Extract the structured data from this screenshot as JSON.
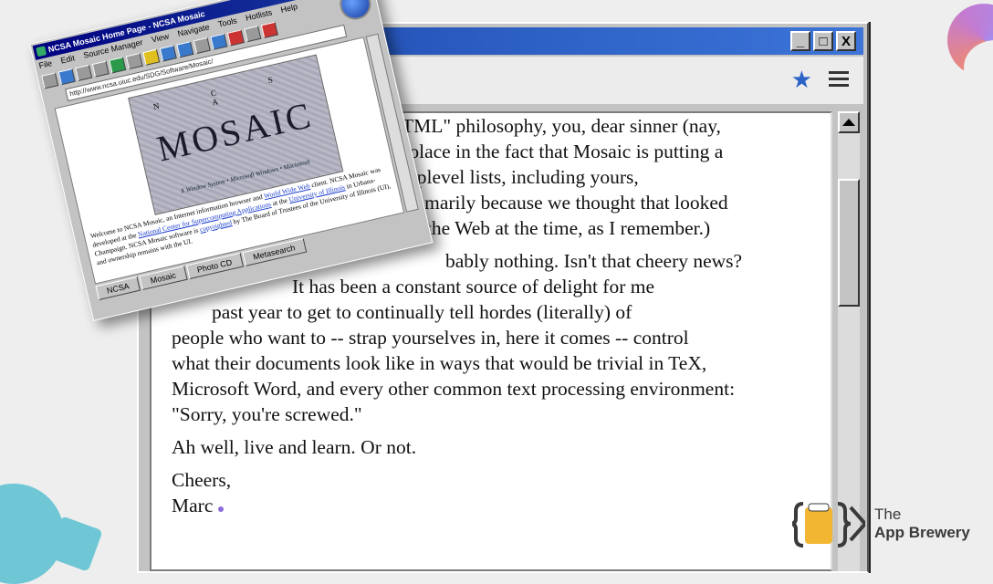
{
  "window": {
    "controls": [
      "_",
      "□",
      "X"
    ]
  },
  "toolbar": {
    "star_icon": "★",
    "menu_icon": "hamburger-icon"
  },
  "article": {
    "paragraph1": [
      "TML\" philosophy, you, dear sinner (nay,",
      "solace in the fact that Mosaic is putting a",
      "toplevel lists, including yours,",
      "Primarily because we thought that looked",
      "on the Web at the time, as I remember.)"
    ],
    "paragraph2": [
      "bably nothing. Isn't that cheery news?",
      "It has been a constant source of delight for me",
      "past year to get to continually tell hordes (literally) of",
      "people who want to -- strap yourselves in, here it comes -- control",
      "what their documents look like in ways that would be trivial in TeX,",
      "Microsoft Word, and every other common text processing environment:",
      "\"Sorry, you're screwed.\""
    ],
    "paragraph3": "Ah well, live and learn. Or not.",
    "closing": "Cheers,",
    "signature": "Marc"
  },
  "mosaic": {
    "title": "NCSA Mosaic Home Page - NCSA Mosaic",
    "menu": [
      "File",
      "Edit",
      "Source Manager",
      "View",
      "Navigate",
      "Tools",
      "Hotlists",
      "Help"
    ],
    "url": "http://www.ncsa.uiuc.edu/SDG/Software/Mosaic/",
    "logo_top": "N C S A",
    "logo_word": "MOSAIC",
    "logo_sub": "X Window System • Microsoft Windows • Macintosh",
    "welcome_parts": [
      "Welcome to NCSA Mosaic, an Internet information browser and ",
      "World Wide Web",
      " client. NCSA Mosaic was developed at the ",
      "National Center for Supercomputing Applications",
      " at the ",
      "University of Illinois",
      " in Urbana-Champaign. NCSA Mosaic software is ",
      "copyrighted",
      " by The Board of Trustees of the University of Illinois (UI), and ownership remains with the UI."
    ],
    "tabs": [
      "NCSA",
      "Mosaic",
      "Photo CD",
      "Metasearch"
    ]
  },
  "brand": {
    "line1": "The",
    "line2": "App Brewery"
  },
  "colors": {
    "title_bar": "#2f63c8",
    "star": "#2b63c8",
    "brand_yellow": "#f2b632"
  }
}
